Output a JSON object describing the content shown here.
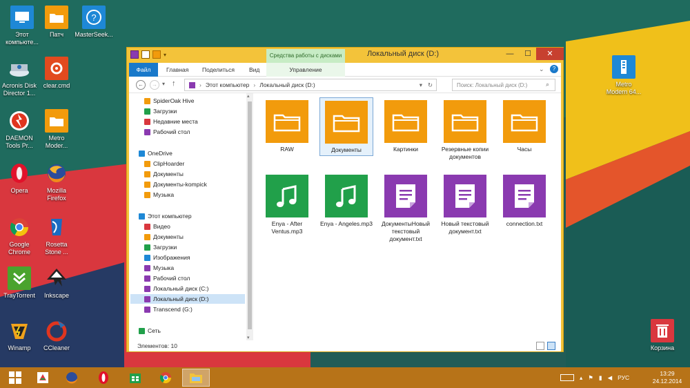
{
  "desktop": {
    "icons_left": [
      {
        "label": "Этот компьюте...",
        "icon": "computer-icon"
      },
      {
        "label": "Патч",
        "icon": "folder-icon"
      },
      {
        "label": "MasterSeek...",
        "icon": "help-icon"
      },
      {
        "label": "Acronis Disk Director 1...",
        "icon": "acronis-icon"
      },
      {
        "label": "clear.cmd",
        "icon": "cmd-icon"
      },
      {
        "label": "DAEMON Tools Pr...",
        "icon": "daemon-icon"
      },
      {
        "label": "Metro Moder...",
        "icon": "folder-icon"
      },
      {
        "label": "Opera",
        "icon": "opera-icon"
      },
      {
        "label": "Mozilla Firefox",
        "icon": "firefox-icon"
      },
      {
        "label": "Google Chrome",
        "icon": "chrome-icon"
      },
      {
        "label": "Rosetta Stone ...",
        "icon": "rosetta-icon"
      },
      {
        "label": "TrayTorrent",
        "icon": "traytorrent-icon"
      },
      {
        "label": "Inkscape",
        "icon": "inkscape-icon"
      },
      {
        "label": "Winamp",
        "icon": "winamp-icon"
      },
      {
        "label": "CCleaner",
        "icon": "ccleaner-icon"
      }
    ],
    "icons_right": [
      {
        "label": "Metro Modern 64...",
        "icon": "zip-icon"
      },
      {
        "label": "Корзина",
        "icon": "recycle-bin-icon"
      }
    ]
  },
  "window": {
    "title": "Локальный диск (D:)",
    "context_group": "Средства работы с дисками",
    "ribbon_tabs": [
      "Файл",
      "Главная",
      "Поделиться",
      "Вид",
      "Управление"
    ],
    "breadcrumb": [
      "Этот компьютер",
      "Локальный диск (D:)"
    ],
    "search_placeholder": "Поиск: Локальный диск (D:)",
    "status": "Элементов: 10"
  },
  "nav": {
    "favorites": [
      "SpiderOak Hive",
      "Загрузки",
      "Недавние места",
      "Рабочий стол"
    ],
    "onedrive_header": "OneDrive",
    "onedrive": [
      "ClipHoarder",
      "Документы",
      "Документы-kompick",
      "Музыка"
    ],
    "computer_header": "Этот компьютер",
    "computer": [
      "Видео",
      "Документы",
      "Загрузки",
      "Изображения",
      "Музыка",
      "Рабочий стол",
      "Локальный диск (C:)",
      "Локальный диск (D:)",
      "Transcend (G:)"
    ],
    "network": "Сеть"
  },
  "files": [
    {
      "name": "RAW",
      "type": "folder"
    },
    {
      "name": "Документы",
      "type": "folder"
    },
    {
      "name": "Картинки",
      "type": "folder"
    },
    {
      "name": "Резервные копии документов",
      "type": "folder"
    },
    {
      "name": "Часы",
      "type": "folder"
    },
    {
      "name": "Enya - After Ventus.mp3",
      "type": "music"
    },
    {
      "name": "Enya - Angeles.mp3",
      "type": "music"
    },
    {
      "name": "ДокументыНовый текстовый документ.txt",
      "type": "text"
    },
    {
      "name": "Новый текстовый документ.txt",
      "type": "text"
    },
    {
      "name": "connection.txt",
      "type": "text"
    }
  ],
  "taskbar": {
    "lang": "РУС",
    "time": "13:29",
    "date": "24.12.2014"
  },
  "colors": {
    "folder": "#f29b0c",
    "music": "#21a04a",
    "text": "#8a3ab0",
    "taskbar": "#b77318",
    "window_frame": "#f3c33a",
    "ribbon_file": "#1979ca"
  }
}
